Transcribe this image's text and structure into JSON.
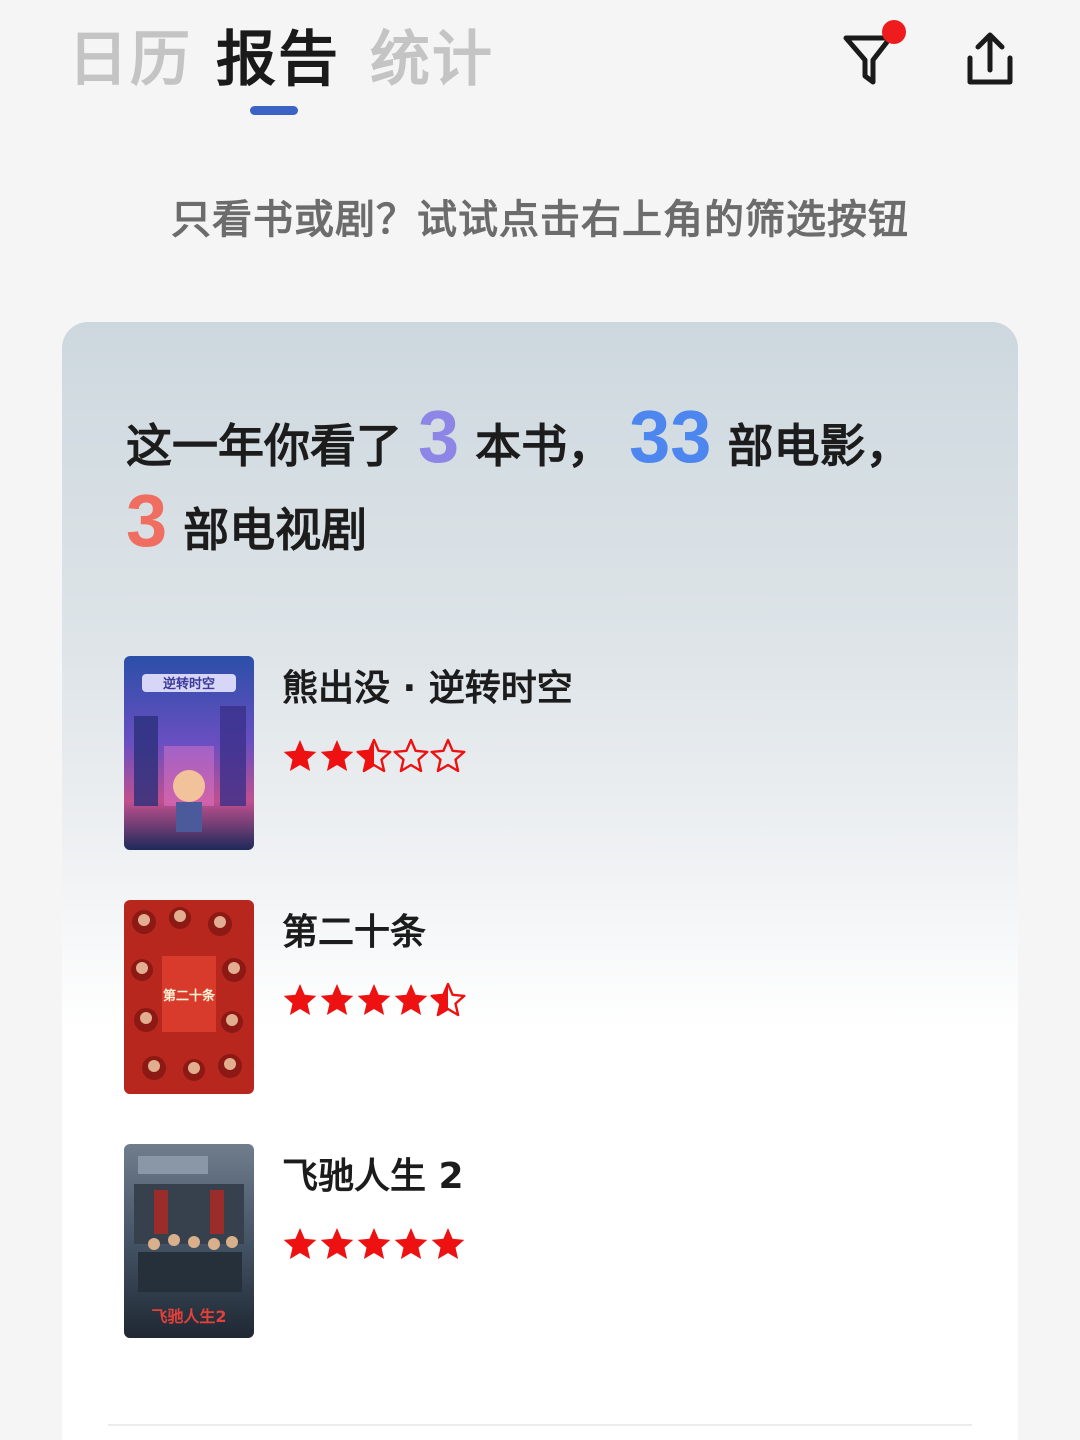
{
  "tabs": [
    {
      "label": "日历",
      "active": false
    },
    {
      "label": "报告",
      "active": true
    },
    {
      "label": "统计",
      "active": false
    }
  ],
  "toolbar": {
    "filter_icon": "filter-icon",
    "filter_has_badge": true,
    "share_icon": "share-icon"
  },
  "hint": "只看书或剧？试试点击右上角的筛选按钮",
  "summary": {
    "prefix": "这一年你看了",
    "books_count": "3",
    "books_unit": "本书，",
    "movies_count": "33",
    "movies_unit": "部电影，",
    "tv_count": "3",
    "tv_unit": "部电视剧"
  },
  "items": [
    {
      "title": "熊出没 · 逆转时空",
      "rating": 2.5,
      "poster_text": "逆转时空"
    },
    {
      "title": "第二十条",
      "rating": 4.5,
      "poster_text": "第二十条"
    },
    {
      "title": "飞驰人生 2",
      "rating": 5,
      "poster_text": "飞驰人生2"
    }
  ],
  "colors": {
    "accent": "#3b63c4",
    "books_count": "#8e86e6",
    "movies_count": "#4e86ef",
    "tv_count": "#ef6e61",
    "star": "#ee1111",
    "badge": "#ee1c1c"
  }
}
